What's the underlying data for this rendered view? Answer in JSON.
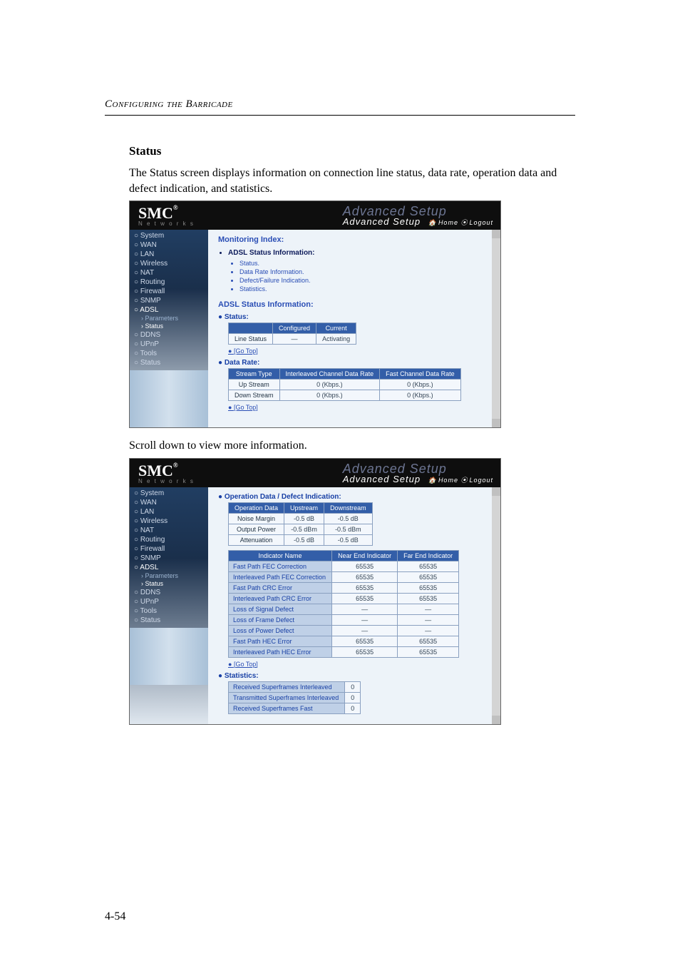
{
  "header": {
    "pre_title": "Configuring the Barricade"
  },
  "section": {
    "title": "Status"
  },
  "paragraphs": {
    "intro": "The Status screen displays information on connection line status, data rate, operation data and defect indication, and statistics.",
    "scroll_note": "Scroll down to view more information."
  },
  "page_number": "4-54",
  "brand": {
    "logo": "SMC",
    "reg": "®",
    "networks": "N e t w o r k s"
  },
  "adv": {
    "line1": "Advanced Setup",
    "line2": "Advanced Setup",
    "home": "Home",
    "logout": "Logout"
  },
  "nav": {
    "items": [
      "System",
      "WAN",
      "LAN",
      "Wireless",
      "NAT",
      "Routing",
      "Firewall",
      "SNMP",
      "ADSL",
      "DDNS",
      "UPnP",
      "Tools",
      "Status"
    ],
    "adsl_sub": [
      "Parameters",
      "Status"
    ]
  },
  "shot1": {
    "monitoring": "Monitoring Index:",
    "adsl_info_lead": "ADSL Status Information:",
    "adsl_info_items": [
      "Status.",
      "Data Rate Information.",
      "Defect/Failure Indication.",
      "Statistics."
    ],
    "status_heading": "ADSL Status Information:",
    "status_lead": "Status:",
    "status_cols": [
      "",
      "Configured",
      "Current"
    ],
    "status_row": {
      "label": "Line Status",
      "configured": "—",
      "current": "Activating"
    },
    "go_top": "[Go Top]",
    "data_rate_lead": "Data Rate:",
    "dr_cols": [
      "Stream Type",
      "Interleaved Channel Data Rate",
      "Fast Channel Data Rate"
    ],
    "dr_rows": [
      {
        "type": "Up Stream",
        "interleaved": "0 (Kbps.)",
        "fast": "0 (Kbps.)"
      },
      {
        "type": "Down Stream",
        "interleaved": "0 (Kbps.)",
        "fast": "0 (Kbps.)"
      }
    ]
  },
  "shot2": {
    "op_lead": "Operation Data / Defect Indication:",
    "op_cols": [
      "Operation Data",
      "Upstream",
      "Downstream"
    ],
    "op_rows": [
      {
        "name": "Noise Margin",
        "up": "-0.5 dB",
        "down": "-0.5 dB"
      },
      {
        "name": "Output Power",
        "up": "-0.5 dBm",
        "down": "-0.5 dBm"
      },
      {
        "name": "Attenuation",
        "up": "-0.5 dB",
        "down": "-0.5 dB"
      }
    ],
    "ind_cols": [
      "Indicator Name",
      "Near End Indicator",
      "Far End Indicator"
    ],
    "ind_rows": [
      {
        "name": "Fast Path FEC Correction",
        "near": "65535",
        "far": "65535"
      },
      {
        "name": "Interleaved Path FEC Correction",
        "near": "65535",
        "far": "65535"
      },
      {
        "name": "Fast Path CRC Error",
        "near": "65535",
        "far": "65535"
      },
      {
        "name": "Interleaved Path CRC Error",
        "near": "65535",
        "far": "65535"
      },
      {
        "name": "Loss of Signal Defect",
        "near": "—",
        "far": "—"
      },
      {
        "name": "Loss of Frame Defect",
        "near": "—",
        "far": "—"
      },
      {
        "name": "Loss of Power Defect",
        "near": "—",
        "far": "—"
      },
      {
        "name": "Fast Path HEC Error",
        "near": "65535",
        "far": "65535"
      },
      {
        "name": "Interleaved Path HEC Error",
        "near": "65535",
        "far": "65535"
      }
    ],
    "go_top": "[Go Top]",
    "stats_lead": "Statistics:",
    "stats_rows": [
      {
        "name": "Received Superframes Interleaved",
        "val": "0"
      },
      {
        "name": "Transmitted Superframes Interleaved",
        "val": "0"
      },
      {
        "name": "Received Superframes Fast",
        "val": "0"
      }
    ]
  }
}
